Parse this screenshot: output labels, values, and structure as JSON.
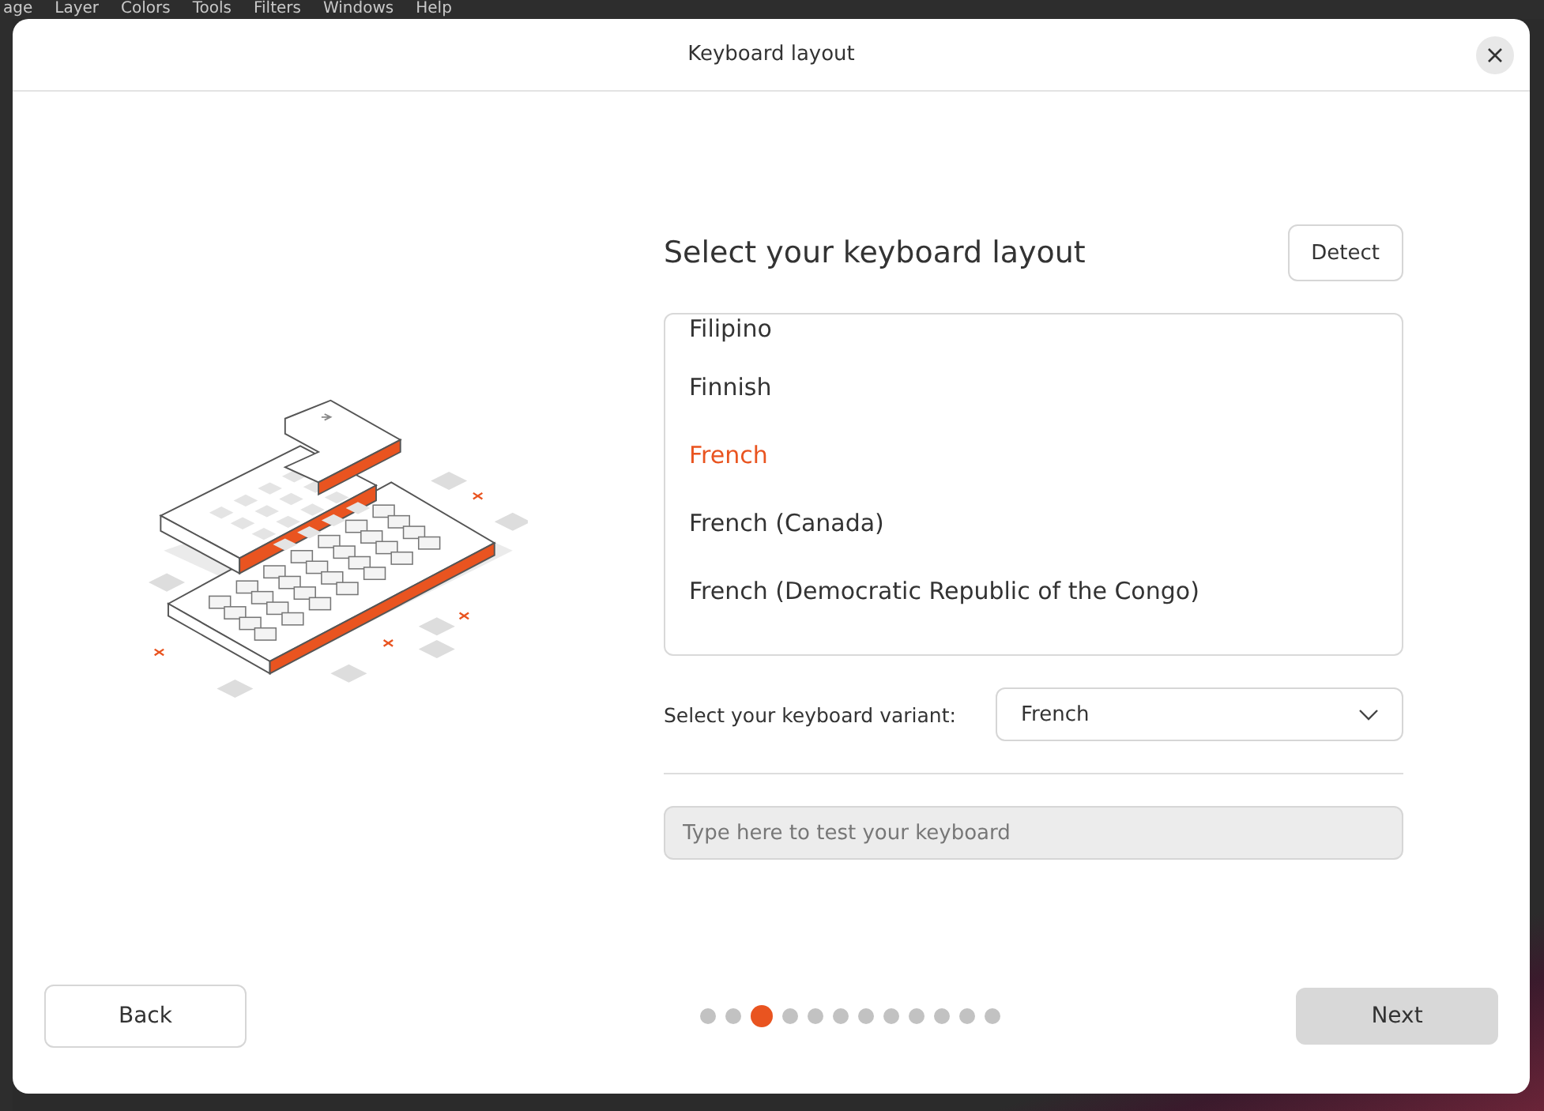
{
  "background_menu": [
    "age",
    "Layer",
    "Colors",
    "Tools",
    "Filters",
    "Windows",
    "Help"
  ],
  "window": {
    "title": "Keyboard layout"
  },
  "heading": "Select your keyboard layout",
  "detect_button": "Detect",
  "layouts": [
    {
      "label": "Filipino",
      "selected": false
    },
    {
      "label": "Finnish",
      "selected": false
    },
    {
      "label": "French",
      "selected": true
    },
    {
      "label": "French (Canada)",
      "selected": false
    },
    {
      "label": "French (Democratic Republic of the Congo)",
      "selected": false
    }
  ],
  "variant": {
    "label": "Select your keyboard variant:",
    "value": "French"
  },
  "test_field": {
    "placeholder": "Type here to test your keyboard"
  },
  "back_button": "Back",
  "next_button": "Next",
  "steps": [
    {
      "selected": false
    },
    {
      "selected": false
    },
    {
      "selected": true
    },
    {
      "selected": false
    },
    {
      "selected": false
    },
    {
      "selected": false
    },
    {
      "selected": false
    },
    {
      "selected": false
    },
    {
      "selected": false
    },
    {
      "selected": false
    },
    {
      "selected": false
    },
    {
      "selected": false
    }
  ]
}
